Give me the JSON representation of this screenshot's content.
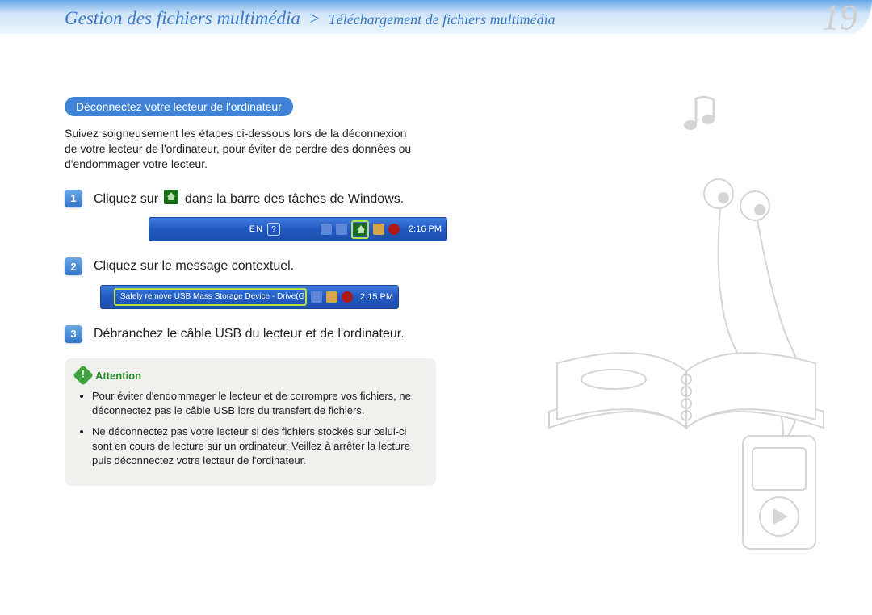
{
  "page_number": "19",
  "breadcrumb": {
    "main": "Gestion des fichiers multimédia",
    "separator": ">",
    "sub": "Téléchargement de fichiers multimédia"
  },
  "section_title": "Déconnectez votre lecteur de l'ordinateur",
  "intro_paragraph": "Suivez soigneusement les étapes ci-dessous lors de la déconnexion de votre lecteur de l'ordinateur, pour éviter de perdre des données ou d'endommager votre lecteur.",
  "steps": [
    {
      "num": "1",
      "text_before": "Cliquez sur ",
      "text_after": " dans la barre des tâches de Windows.",
      "taskbar": {
        "lang": "EN",
        "time": "2:16 PM"
      }
    },
    {
      "num": "2",
      "text": "Cliquez sur le message contextuel.",
      "popup": {
        "message": "Safely remove USB Mass Storage Device - Drive(G:)",
        "time": "2:15 PM"
      }
    },
    {
      "num": "3",
      "text": "Débranchez le câble USB du lecteur et de l'ordinateur."
    }
  ],
  "attention": {
    "label": "Attention",
    "items": [
      "Pour éviter d'endommager le lecteur et de corrompre vos fichiers, ne déconnectez pas le câble USB lors du transfert de fichiers.",
      "Ne déconnectez pas votre lecteur si des fichiers stockés sur celui-ci sont en cours de lecture sur un ordinateur. Veillez à arrêter la lecture puis déconnectez votre lecteur de l'ordinateur."
    ]
  }
}
